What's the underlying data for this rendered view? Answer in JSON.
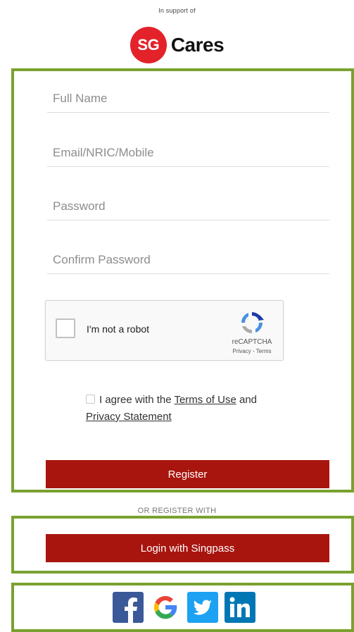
{
  "header": {
    "support_text": "In support of",
    "logo_badge": "SG",
    "logo_word": "Cares",
    "logo_color": "#e3222a"
  },
  "form": {
    "full_name_placeholder": "Full Name",
    "email_placeholder": "Email/NRIC/Mobile",
    "password_placeholder": "Password",
    "confirm_password_placeholder": "Confirm Password",
    "captcha": {
      "label": "I'm not a robot",
      "brand": "reCAPTCHA",
      "links": "Privacy - Terms"
    },
    "agree": {
      "prefix": "I agree with the",
      "terms_link": "Terms of Use",
      "middle": "and",
      "privacy_link": "Privacy Statement"
    },
    "register_label": "Register"
  },
  "alt": {
    "or_text": "OR REGISTER WITH",
    "singpass_label": "Login with Singpass"
  },
  "social": {
    "icons": [
      "facebook-icon",
      "google-icon",
      "twitter-icon",
      "linkedin-icon"
    ]
  },
  "colors": {
    "accent_button": "#a8150f",
    "highlight_border": "#7aa12f"
  }
}
